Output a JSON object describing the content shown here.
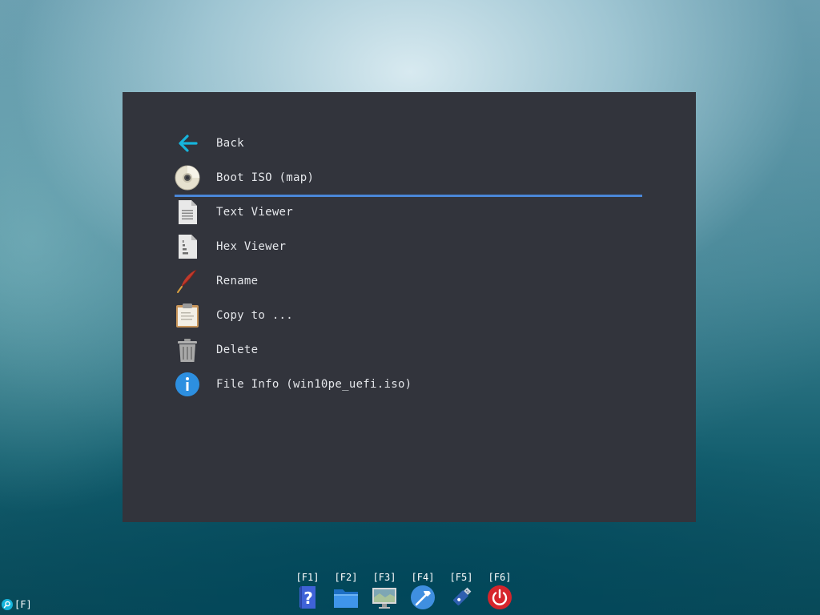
{
  "menu": {
    "items": [
      {
        "label": "Back",
        "icon": "back-arrow-icon"
      },
      {
        "label": "Boot ISO (map)",
        "icon": "disc-icon",
        "selected": true
      },
      {
        "label": "Text Viewer",
        "icon": "text-file-icon"
      },
      {
        "label": "Hex Viewer",
        "icon": "hex-file-icon"
      },
      {
        "label": "Rename",
        "icon": "quill-icon"
      },
      {
        "label": "Copy to ...",
        "icon": "clipboard-icon"
      },
      {
        "label": "Delete",
        "icon": "trash-icon"
      },
      {
        "label": "File Info (win10pe_uefi.iso)",
        "icon": "info-icon"
      }
    ]
  },
  "dock": [
    {
      "key": "[F1]",
      "icon": "help-icon"
    },
    {
      "key": "[F2]",
      "icon": "folder-icon"
    },
    {
      "key": "[F3]",
      "icon": "monitor-icon"
    },
    {
      "key": "[F4]",
      "icon": "hammer-tools-icon"
    },
    {
      "key": "[F5]",
      "icon": "usb-drive-icon"
    },
    {
      "key": "[F6]",
      "icon": "power-icon"
    }
  ],
  "corner": {
    "key": "[F]",
    "icon": "search-icon"
  },
  "colors": {
    "panel": "#32343c",
    "selection": "#4a87d8",
    "text": "#e4e6ea",
    "accent_cyan": "#16b4dc"
  }
}
